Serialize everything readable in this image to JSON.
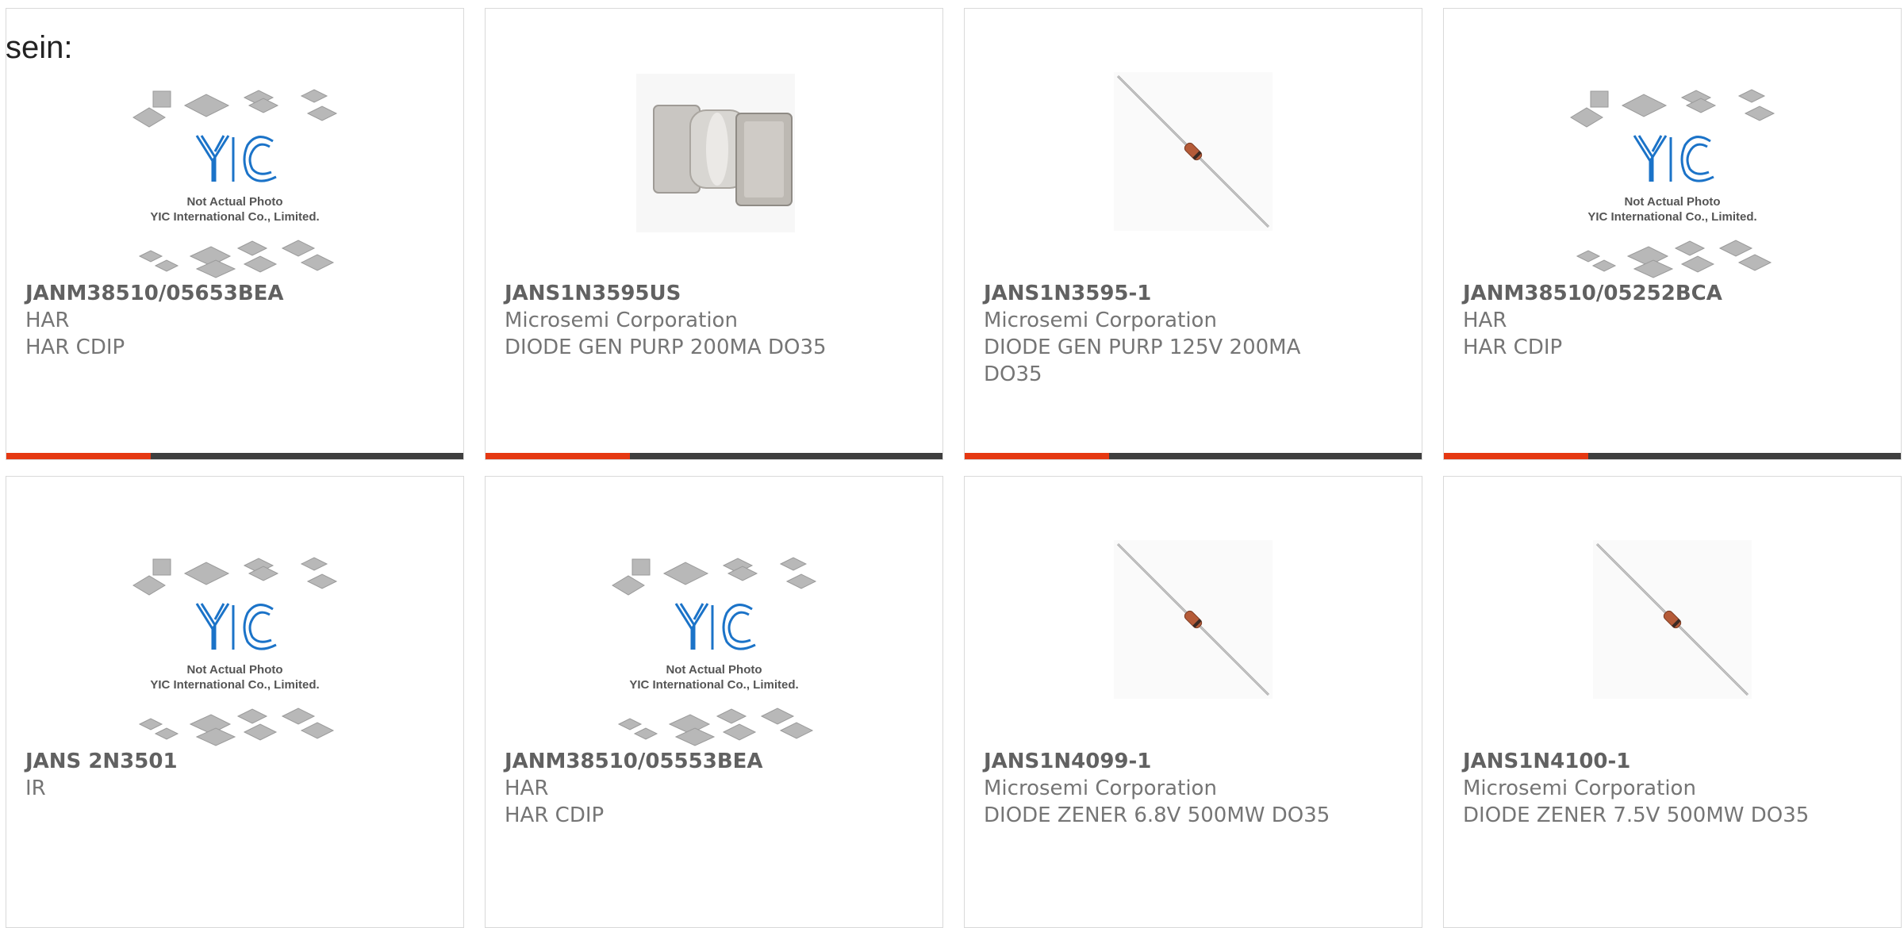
{
  "lead_text": "sein:",
  "placeholder": {
    "line1": "Not Actual Photo",
    "line2": "YIC International Co., Limited.",
    "logo": "YIC"
  },
  "colors": {
    "accent": "#e53812",
    "bar": "#3f3f3f",
    "logo_blue": "#1b73c8"
  },
  "products": [
    {
      "part": "JANM38510/05653BEA",
      "manufacturer": "HAR",
      "description": "HAR CDIP",
      "image": "yic-placeholder-icon"
    },
    {
      "part": "JANS1N3595US",
      "manufacturer": "Microsemi Corporation",
      "description": "DIODE GEN PURP 200MA DO35",
      "image": "smd-diode-photo"
    },
    {
      "part": "JANS1N3595-1",
      "manufacturer": "Microsemi Corporation",
      "description": "DIODE GEN PURP 125V 200MA",
      "description2": "DO35",
      "image": "axial-diode-photo"
    },
    {
      "part": "JANM38510/05252BCA",
      "manufacturer": "HAR",
      "description": "HAR CDIP",
      "image": "yic-placeholder-icon"
    },
    {
      "part": "JANS 2N3501",
      "manufacturer": "IR",
      "description": "",
      "image": "yic-placeholder-icon"
    },
    {
      "part": "JANM38510/05553BEA",
      "manufacturer": "HAR",
      "description": "HAR CDIP",
      "image": "yic-placeholder-icon"
    },
    {
      "part": "JANS1N4099-1",
      "manufacturer": "Microsemi Corporation",
      "description": "DIODE ZENER 6.8V 500MW DO35",
      "image": "axial-diode-photo"
    },
    {
      "part": "JANS1N4100-1",
      "manufacturer": "Microsemi Corporation",
      "description": "DIODE ZENER 7.5V 500MW DO35",
      "image": "axial-diode-photo"
    }
  ]
}
